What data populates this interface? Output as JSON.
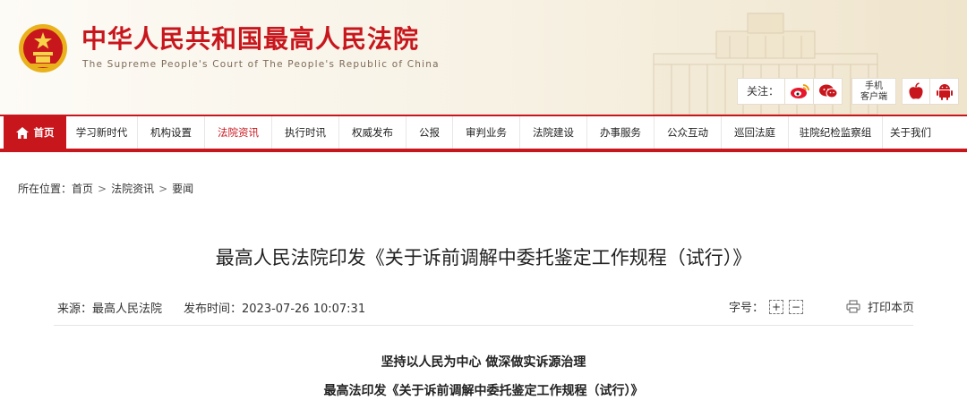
{
  "header": {
    "title": "中华人民共和国最高人民法院",
    "subtitle": "The Supreme People's Court of The People's Republic of China",
    "follow_label": "关注：",
    "weibo_icon": "weibo-icon",
    "wechat_icon": "wechat-icon",
    "mobile_label_line1": "手机",
    "mobile_label_line2": "客户端",
    "apple_icon": "apple-icon",
    "android_icon": "android-icon",
    "colors": {
      "brand_red": "#c8161d",
      "emblem_gold": "#e9b21c"
    }
  },
  "nav": {
    "home": "首页",
    "items": [
      "学习新时代",
      "机构设置",
      "法院资讯",
      "执行时讯",
      "权威发布",
      "公报",
      "审判业务",
      "法院建设",
      "办事服务",
      "公众互动",
      "巡回法庭",
      "驻院纪检监察组",
      "关于我们"
    ],
    "active_index": 2
  },
  "breadcrumb": {
    "prefix": "所在位置：",
    "items": [
      "首页",
      "法院资讯",
      "要闻"
    ],
    "separator": ">"
  },
  "article": {
    "title": "最高人民法院印发《关于诉前调解中委托鉴定工作规程（试行）》",
    "source": "来源：最高人民法院",
    "published": "发布时间：2023-07-26 10:07:31",
    "font_label": "字号：",
    "font_increase": "+",
    "font_decrease": "−",
    "print_label": "打印本页",
    "headings": [
      "坚持以人民为中心 做深做实诉源治理",
      "最高法印发《关于诉前调解中委托鉴定工作规程（试行）》"
    ]
  }
}
